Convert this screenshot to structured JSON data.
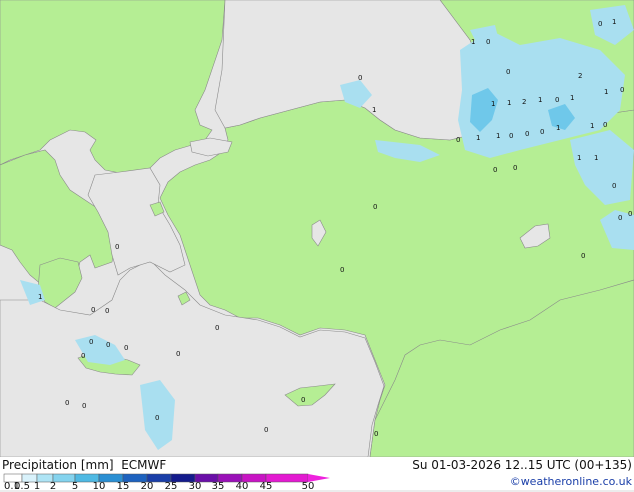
{
  "title": "Precipitation [mm]",
  "model": "ECMWF",
  "datetime": "Su 01-03-2026 12..15 UTC (00+135)",
  "credit": "©weatheronline.co.uk",
  "colors": {
    "sea": "#e6e6e6",
    "land_precip": "#b5ee94",
    "light_precip": "#a9dff0",
    "medium_precip": "#6fc8ea",
    "coast": "#8a8a8a"
  },
  "legend": {
    "ticks": [
      "0.1",
      "0.5",
      "1",
      "2",
      "5",
      "10",
      "15",
      "20",
      "25",
      "30",
      "35",
      "40",
      "45",
      "50"
    ],
    "colors": [
      "#ffffff",
      "#d9f2fb",
      "#aee4f5",
      "#84d3ee",
      "#4fb9e3",
      "#2b8fd3",
      "#1d62bf",
      "#1a3ea8",
      "#141b8c",
      "#6a0fa8",
      "#9a10b8",
      "#c814c4",
      "#e31ad1"
    ]
  },
  "map_labels": [
    "1",
    "0",
    "0",
    "0",
    "1",
    "1",
    "2",
    "1",
    "0",
    "1",
    "1",
    "1",
    "1",
    "0",
    "0",
    "0",
    "1",
    "1",
    "2",
    "1",
    "0",
    "1",
    "0",
    "0",
    "1",
    "0",
    "0",
    "0",
    "0",
    "0",
    "0",
    "0",
    "0",
    "0",
    "0",
    "0",
    "0",
    "0",
    "0",
    "0",
    "0",
    "0",
    "0",
    "0",
    "1",
    "0",
    "1",
    "0",
    "0",
    "0",
    "0"
  ]
}
